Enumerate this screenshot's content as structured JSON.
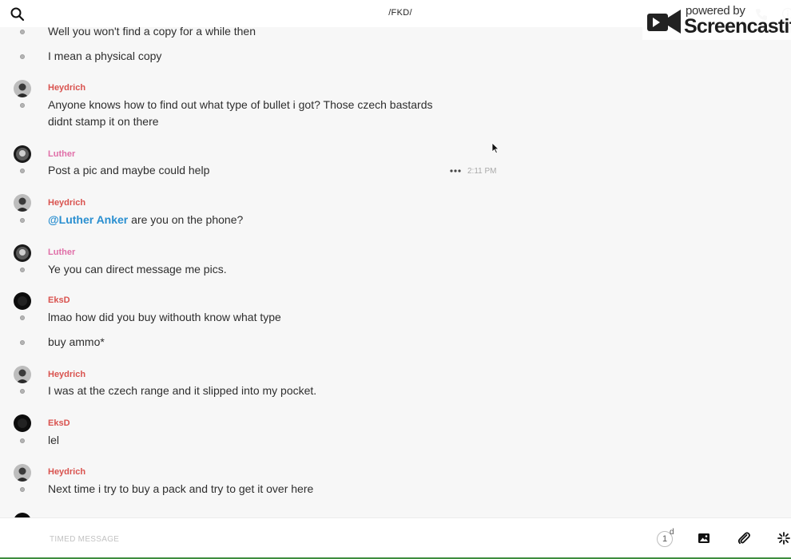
{
  "header": {
    "channel_title": "/FKD/",
    "icons": [
      "search-icon",
      "phone-icon",
      "info-icon"
    ]
  },
  "watermark": {
    "powered": "powered by",
    "brand": "Screencastify"
  },
  "messages": [
    {
      "author": "",
      "text": "Well you won't find a copy for a while then"
    },
    {
      "author": "",
      "text": "I mean a physical copy"
    },
    {
      "author": "Heydrich",
      "text_line1": "Anyone knows how to find out what type of bullet i got? Those czech bastards",
      "text_line2": "didnt stamp it on there"
    },
    {
      "author": "Luther",
      "text": "Post a pic and maybe could help",
      "timestamp": "2:11 PM"
    },
    {
      "author": "Heydrich",
      "mention": "@Luther Anker",
      "text": " are you on the phone?"
    },
    {
      "author": "Luther",
      "text": "Ye you can direct message me pics."
    },
    {
      "author": "EksD",
      "text": "lmao how did you buy withouth know what type"
    },
    {
      "author": "",
      "text": "buy ammo*"
    },
    {
      "author": "Heydrich",
      "text": "I was at the czech range and it slipped into my pocket."
    },
    {
      "author": "EksD",
      "text": "lel"
    },
    {
      "author": "Heydrich",
      "text": "Next time i try to buy a pack and try to get it over here"
    }
  ],
  "composer": {
    "placeholder": "TIMED MESSAGE",
    "timer_value": "1",
    "timer_unit": "d"
  },
  "colors": {
    "heydrich": "#d9534f",
    "luther": "#e06fa8",
    "eksd": "#d9534f",
    "mention": "#2a8fd0"
  }
}
